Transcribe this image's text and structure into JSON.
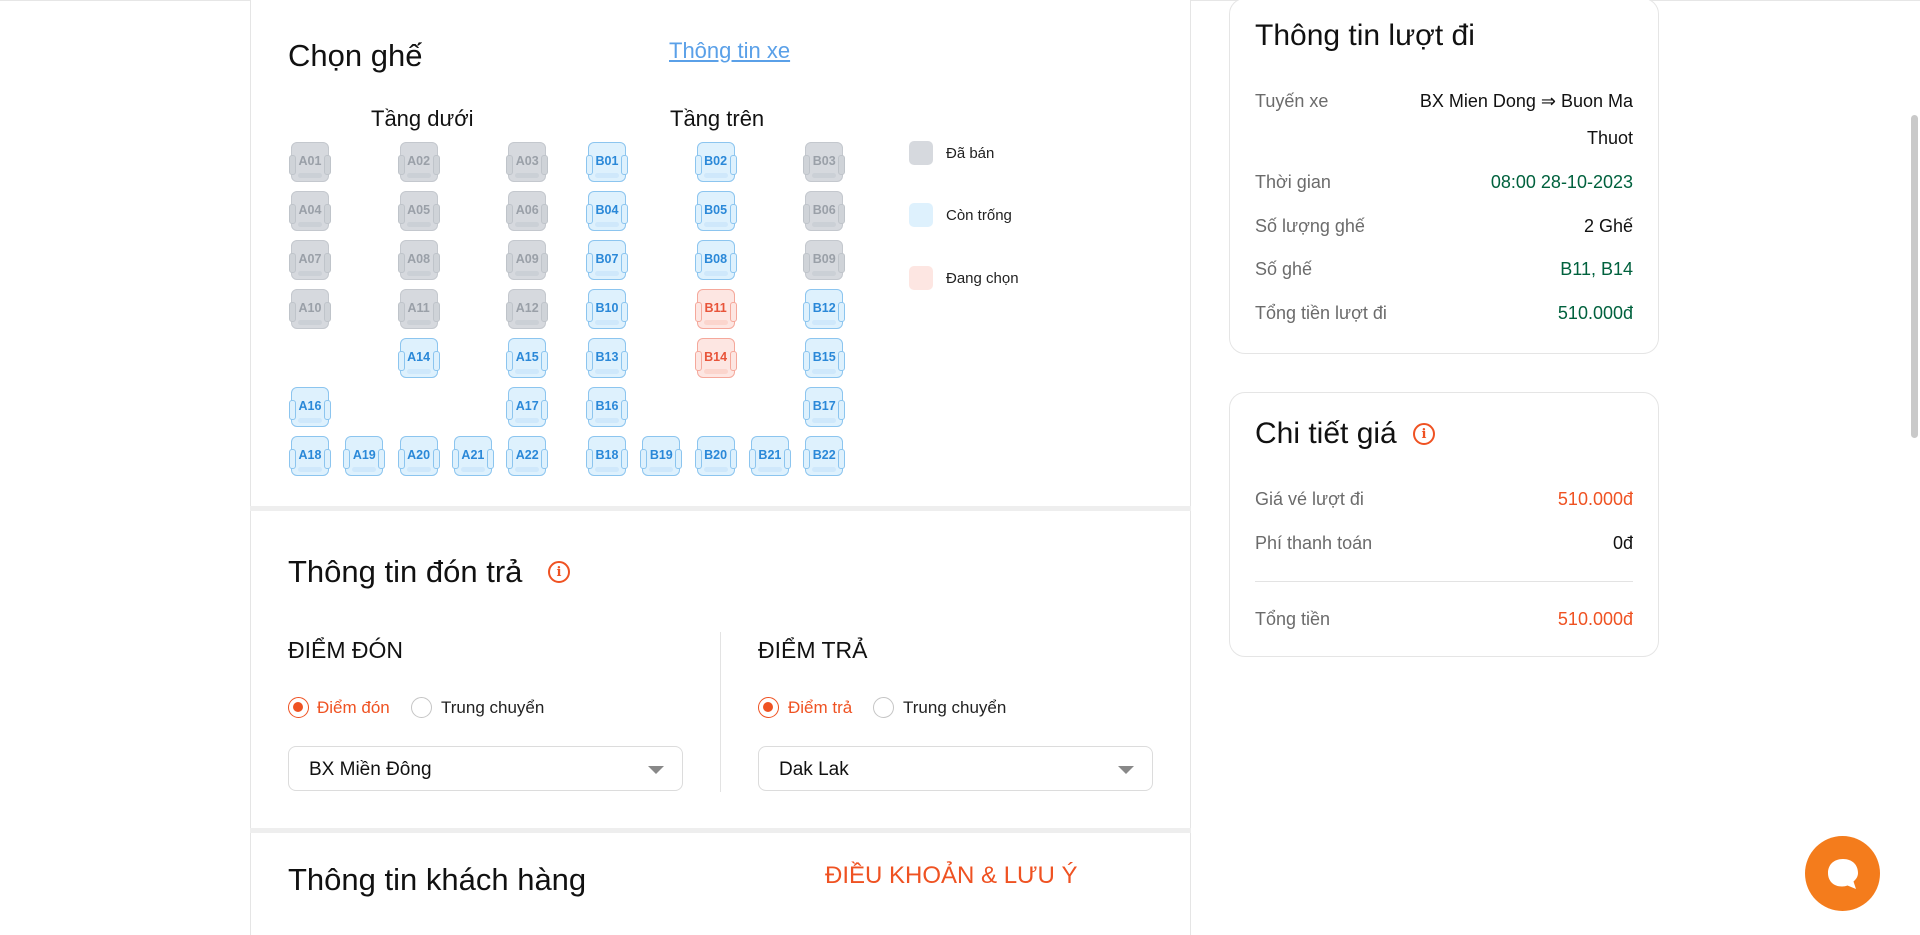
{
  "seat_section": {
    "title": "Chọn ghế",
    "bus_info_link": "Thông tin xe",
    "lower_deck_label": "Tầng dưới",
    "upper_deck_label": "Tầng trên",
    "legend": [
      {
        "label": "Đã bán",
        "status": "sold",
        "color": "#d6d9de"
      },
      {
        "label": "Còn trống",
        "status": "available",
        "color": "#def1fd"
      },
      {
        "label": "Đang chọn",
        "status": "selected",
        "color": "#fde6e2"
      }
    ],
    "lower_seats": [
      {
        "code": "A01",
        "status": "sold"
      },
      {
        "code": "A02",
        "status": "sold"
      },
      {
        "code": "A03",
        "status": "sold"
      },
      {
        "code": "A04",
        "status": "sold"
      },
      {
        "code": "A05",
        "status": "sold"
      },
      {
        "code": "A06",
        "status": "sold"
      },
      {
        "code": "A07",
        "status": "sold"
      },
      {
        "code": "A08",
        "status": "sold"
      },
      {
        "code": "A09",
        "status": "sold"
      },
      {
        "code": "A10",
        "status": "sold"
      },
      {
        "code": "A11",
        "status": "sold"
      },
      {
        "code": "A12",
        "status": "sold"
      },
      {
        "code": "A14",
        "status": "available"
      },
      {
        "code": "A15",
        "status": "available"
      },
      {
        "code": "A16",
        "status": "available"
      },
      {
        "code": "A17",
        "status": "available"
      },
      {
        "code": "A18",
        "status": "available"
      },
      {
        "code": "A19",
        "status": "available"
      },
      {
        "code": "A20",
        "status": "available"
      },
      {
        "code": "A21",
        "status": "available"
      },
      {
        "code": "A22",
        "status": "available"
      }
    ],
    "upper_seats": [
      {
        "code": "B01",
        "status": "available"
      },
      {
        "code": "B02",
        "status": "available"
      },
      {
        "code": "B03",
        "status": "sold"
      },
      {
        "code": "B04",
        "status": "available"
      },
      {
        "code": "B05",
        "status": "available"
      },
      {
        "code": "B06",
        "status": "sold"
      },
      {
        "code": "B07",
        "status": "available"
      },
      {
        "code": "B08",
        "status": "available"
      },
      {
        "code": "B09",
        "status": "sold"
      },
      {
        "code": "B10",
        "status": "available"
      },
      {
        "code": "B11",
        "status": "selected"
      },
      {
        "code": "B12",
        "status": "available"
      },
      {
        "code": "B13",
        "status": "available"
      },
      {
        "code": "B14",
        "status": "selected"
      },
      {
        "code": "B15",
        "status": "available"
      },
      {
        "code": "B16",
        "status": "available"
      },
      {
        "code": "B17",
        "status": "available"
      },
      {
        "code": "B18",
        "status": "available"
      },
      {
        "code": "B19",
        "status": "available"
      },
      {
        "code": "B20",
        "status": "available"
      },
      {
        "code": "B21",
        "status": "available"
      },
      {
        "code": "B22",
        "status": "available"
      }
    ]
  },
  "pickup_section": {
    "title": "Thông tin đón trả",
    "pickup": {
      "heading": "ĐIỂM ĐÓN",
      "option_1": "Điểm đón",
      "option_2": "Trung chuyển",
      "selected_option": "Điểm đón",
      "select_value": "BX Miền Đông"
    },
    "dropoff": {
      "heading": "ĐIỂM TRẢ",
      "option_1": "Điểm trả",
      "option_2": "Trung chuyển",
      "selected_option": "Điểm trả",
      "select_value": "Dak Lak"
    }
  },
  "customer_section": {
    "title": "Thông tin khách hàng",
    "terms_link": "ĐIỀU KHOẢN & LƯU Ý"
  },
  "trip_info": {
    "title": "Thông tin lượt đi",
    "route_label": "Tuyến xe",
    "route_line1": "BX Mien Dong ⇒ Buon Ma",
    "route_line2": "Thuot",
    "time_label": "Thời gian",
    "time_value": "08:00 28-10-2023",
    "seat_count_label": "Số lượng ghế",
    "seat_count_value": "2 Ghế",
    "seat_numbers_label": "Số ghế",
    "seat_numbers_value": "B11, B14",
    "total_label": "Tổng tiền lượt đi",
    "total_value": "510.000đ"
  },
  "price_detail": {
    "title": "Chi tiết giá",
    "ticket_label": "Giá vé lượt đi",
    "ticket_value": "510.000đ",
    "fee_label": "Phí thanh toán",
    "fee_value": "0đ",
    "total_label": "Tổng tiền",
    "total_value": "510.000đ"
  },
  "chat": {
    "icon": "chat-bubble-icon",
    "color": "#f47c1c"
  }
}
